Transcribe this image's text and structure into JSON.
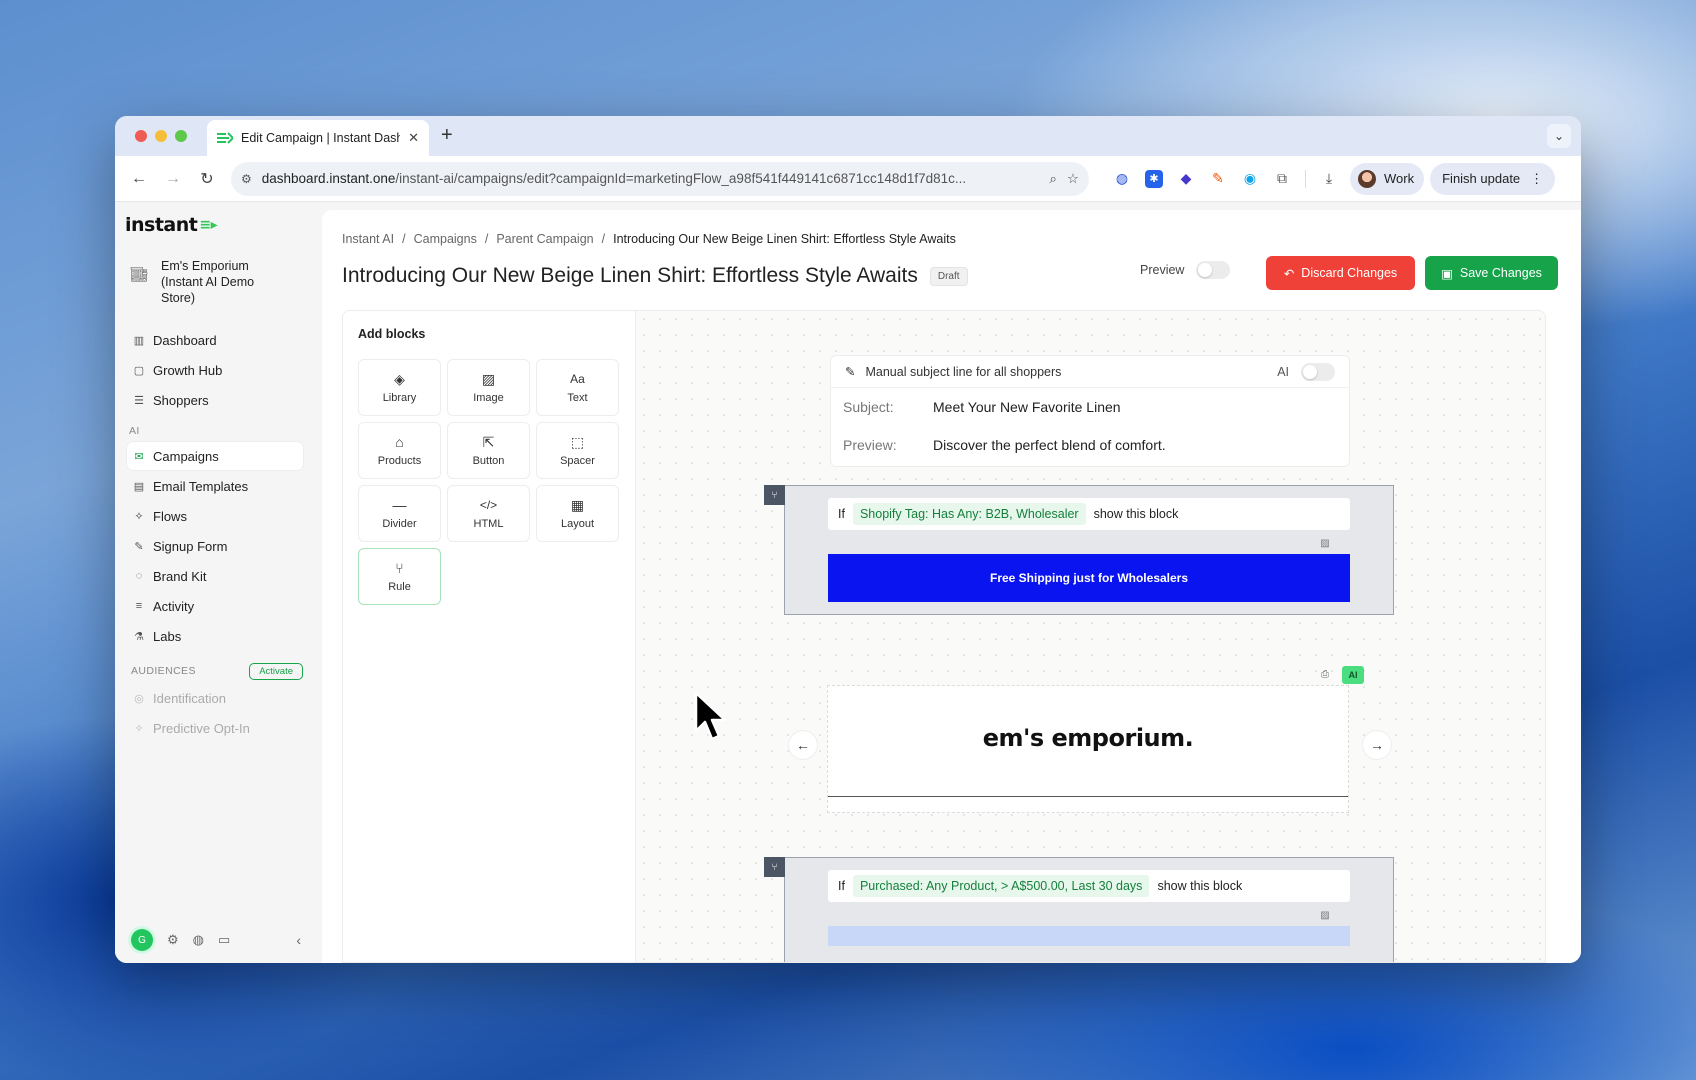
{
  "browser": {
    "tab_title": "Edit Campaign | Instant Dashb",
    "url_host": "dashboard.instant.one",
    "url_path": "/instant-ai/campaigns/edit?campaignId=marketingFlow_a98f541f449141c6871cc148d1f7d81c...",
    "profile": "Work",
    "finish_update": "Finish update"
  },
  "sidebar": {
    "logo": "instant",
    "store_name": "Em's Emporium (Instant AI Demo Store)",
    "nav_main": [
      "Dashboard",
      "Growth Hub",
      "Shoppers"
    ],
    "ai_label": "AI",
    "nav_ai": [
      "Campaigns",
      "Email Templates",
      "Flows",
      "Signup Form",
      "Brand Kit",
      "Activity",
      "Labs"
    ],
    "audiences_label": "AUDIENCES",
    "activate_label": "Activate",
    "nav_audiences": [
      "Identification",
      "Predictive Opt-In"
    ],
    "user_initial": "G"
  },
  "header": {
    "breadcrumb": [
      "Instant AI",
      "Campaigns",
      "Parent Campaign",
      "Introducing Our New Beige Linen Shirt: Effortless Style Awaits"
    ],
    "title": "Introducing Our New Beige Linen Shirt: Effortless Style Awaits",
    "status": "Draft",
    "preview_label": "Preview",
    "discard_label": "Discard Changes",
    "save_label": "Save Changes"
  },
  "blocks": {
    "title": "Add blocks",
    "items": [
      "Library",
      "Image",
      "Text",
      "Products",
      "Button",
      "Spacer",
      "Divider",
      "HTML",
      "Layout",
      "Rule"
    ]
  },
  "subject": {
    "mode_label": "Manual subject line for all shoppers",
    "ai_label": "AI",
    "subject_label": "Subject:",
    "subject_value": "Meet Your New Favorite Linen",
    "preview_label": "Preview:",
    "preview_value": "Discover the perfect blend of comfort."
  },
  "conditional_1": {
    "if": "If",
    "condition": "Shopify Tag: Has Any: B2B, Wholesaler",
    "suffix": "show this block",
    "cta": "Free Shipping just for Wholesalers"
  },
  "brand": {
    "text": "em's emporium.",
    "ai_badge": "AI"
  },
  "conditional_2": {
    "if": "If",
    "condition": "Purchased: Any Product, > A$500.00, Last 30 days",
    "suffix": "show this block"
  }
}
